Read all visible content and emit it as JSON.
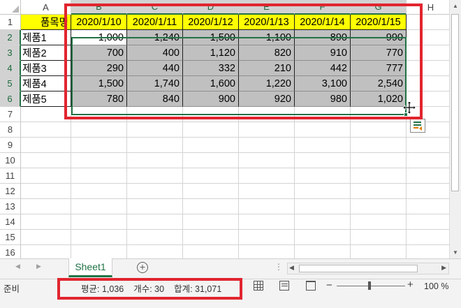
{
  "columns": [
    "A",
    "B",
    "C",
    "D",
    "E",
    "F",
    "G",
    "H"
  ],
  "selected_columns": [
    "B",
    "C",
    "D",
    "E",
    "F",
    "G"
  ],
  "rows": [
    "1",
    "2",
    "3",
    "4",
    "5",
    "6",
    "7",
    "8",
    "9",
    "10",
    "11",
    "12",
    "13",
    "14",
    "15",
    "16"
  ],
  "selected_rows": [
    "2",
    "3",
    "4",
    "5",
    "6"
  ],
  "header_row": {
    "item_label": "품목명",
    "dates": [
      "2020/1/10",
      "2020/1/11",
      "2020/1/12",
      "2020/1/13",
      "2020/1/14",
      "2020/1/15"
    ]
  },
  "products": [
    {
      "name": "제품1",
      "values": [
        "1,000",
        "1,240",
        "1,500",
        "1,100",
        "890",
        "990"
      ]
    },
    {
      "name": "제품2",
      "values": [
        "700",
        "400",
        "1,120",
        "820",
        "910",
        "770"
      ]
    },
    {
      "name": "제품3",
      "values": [
        "290",
        "440",
        "332",
        "210",
        "442",
        "777"
      ]
    },
    {
      "name": "제품4",
      "values": [
        "1,500",
        "1,740",
        "1,600",
        "1,220",
        "3,100",
        "2,540"
      ]
    },
    {
      "name": "제품5",
      "values": [
        "780",
        "840",
        "900",
        "920",
        "980",
        "1,020"
      ]
    }
  ],
  "sheet_tabs": {
    "active": "Sheet1"
  },
  "status_bar": {
    "mode": "준비",
    "average": "평균: 1,036",
    "count": "개수: 30",
    "sum": "합계: 31,071",
    "zoom": "100 %"
  },
  "colors": {
    "header_fill": "#ffff00",
    "selection_fill": "#c0c0c0",
    "selection_border": "#217346",
    "annotation_red": "#e1252f"
  }
}
